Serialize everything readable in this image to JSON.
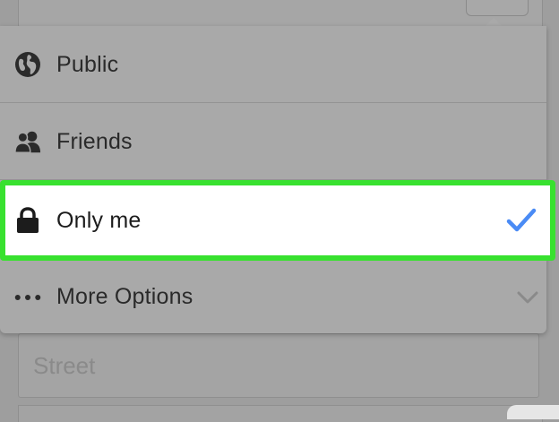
{
  "menu": {
    "items": [
      {
        "label": "Public",
        "icon": "globe-icon"
      },
      {
        "label": "Friends",
        "icon": "friends-icon"
      },
      {
        "label": "Only me",
        "icon": "lock-icon",
        "selected": true
      },
      {
        "label": "More Options",
        "icon": "more-dots-icon"
      }
    ],
    "selected_color": "#4a8bf5",
    "highlight_color": "#38e12f"
  },
  "form": {
    "street_placeholder": "Street"
  }
}
